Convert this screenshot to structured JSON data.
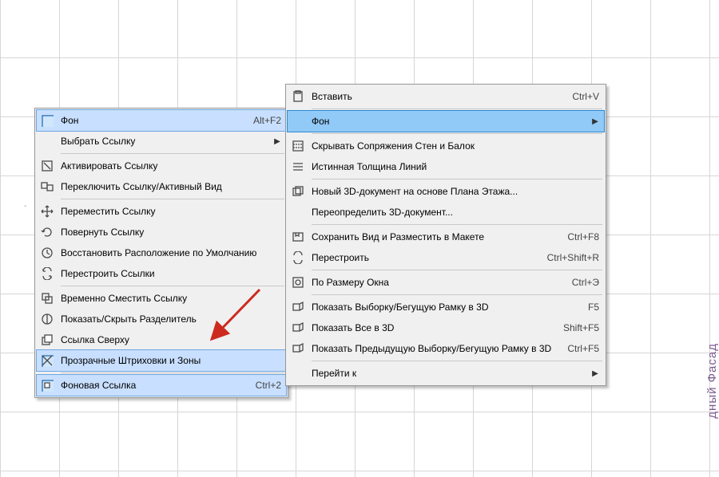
{
  "menu1": {
    "items": [
      {
        "icon": "background-icon",
        "label": "Фон",
        "shortcut": "Alt+F2",
        "selected": true
      },
      {
        "icon": "",
        "label": "Выбрать Ссылку",
        "submenu": true
      }
    ],
    "items2": [
      {
        "icon": "activate-icon",
        "label": "Активировать Ссылку"
      },
      {
        "icon": "toggle-icon",
        "label": "Переключить Ссылку/Активный Вид"
      }
    ],
    "items3": [
      {
        "icon": "move-icon",
        "label": "Переместить Ссылку"
      },
      {
        "icon": "rotate-icon",
        "label": "Повернуть Ссылку"
      },
      {
        "icon": "reset-icon",
        "label": "Восстановить Расположение по Умолчанию"
      },
      {
        "icon": "rebuild-icon",
        "label": "Перестроить Ссылки"
      }
    ],
    "items4": [
      {
        "icon": "offset-icon",
        "label": "Временно Сместить Ссылку"
      },
      {
        "icon": "divider-icon",
        "label": "Показать/Скрыть Разделитель"
      },
      {
        "icon": "ontop-icon",
        "label": "Ссылка Сверху"
      },
      {
        "icon": "transp-icon",
        "label": "Прозрачные Штриховки и Зоны",
        "selected": true
      }
    ],
    "items5": [
      {
        "icon": "bglink-icon",
        "label": "Фоновая Ссылка",
        "shortcut": "Ctrl+2",
        "selected": true
      }
    ]
  },
  "menu2": {
    "g1": [
      {
        "icon": "paste-icon",
        "label": "Вставить",
        "shortcut": "Ctrl+V"
      }
    ],
    "g2": [
      {
        "icon": "",
        "label": "Фон",
        "submenu": true,
        "highlight": true
      }
    ],
    "g3": [
      {
        "icon": "hidejoin-icon",
        "label": "Скрывать Сопряжения Стен и Балок"
      },
      {
        "icon": "truewidth-icon",
        "label": "Истинная Толщина Линий"
      }
    ],
    "g4": [
      {
        "icon": "new3d-icon",
        "label": "Новый 3D-документ на основе Плана Этажа..."
      },
      {
        "icon": "",
        "label": "Переопределить 3D-документ..."
      }
    ],
    "g5": [
      {
        "icon": "saveview-icon",
        "label": "Сохранить Вид и Разместить в Макете",
        "shortcut": "Ctrl+F8"
      },
      {
        "icon": "rebuild2-icon",
        "label": "Перестроить",
        "shortcut": "Ctrl+Shift+R"
      }
    ],
    "g6": [
      {
        "icon": "fit-icon",
        "label": "По Размеру Окна",
        "shortcut": "Ctrl+Э"
      }
    ],
    "g7": [
      {
        "icon": "sel3d-icon",
        "label": "Показать Выборку/Бегущую Рамку в 3D",
        "shortcut": "F5"
      },
      {
        "icon": "all3d-icon",
        "label": "Показать Все в 3D",
        "shortcut": "Shift+F5"
      },
      {
        "icon": "prev3d-icon",
        "label": "Показать Предыдущую Выборку/Бегущую Рамку в 3D",
        "shortcut": "Ctrl+F5"
      }
    ],
    "g8": [
      {
        "icon": "",
        "label": "Перейти к",
        "submenu": true
      }
    ]
  },
  "side_text": "дный Фасад"
}
